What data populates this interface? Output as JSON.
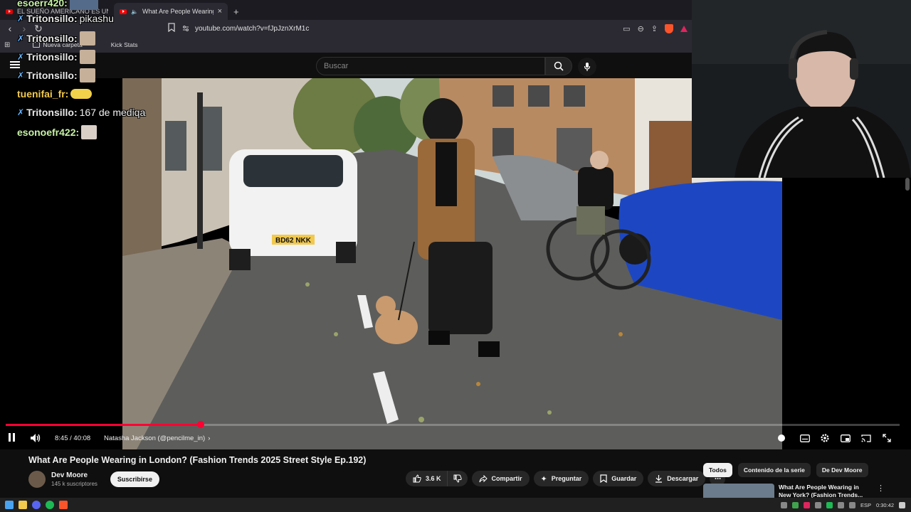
{
  "browser": {
    "tabs": [
      {
        "title": "EL SUEÑO AMERICANO ES UNA PE...",
        "active": false
      },
      {
        "title": "What Are People Wearing in L...",
        "active": true
      }
    ],
    "new_tab_symbol": "+",
    "close_symbol": "×",
    "url": "youtube.com/watch?v=fJpJznXrM1c",
    "bookmarks": [
      {
        "label": "Nueva carpeta"
      },
      {
        "label": "Kick Stats"
      }
    ]
  },
  "youtube": {
    "search_placeholder": "Buscar",
    "player": {
      "current_time": "8:45",
      "separator": " / ",
      "duration": "40:08",
      "chapter": "Natasha Jackson (@pencilme_in)",
      "progress_fraction": 0.2181,
      "plate_number": "BD62 NKK"
    },
    "video": {
      "title": "What Are People Wearing in London? (Fashion Trends 2025 Street Style Ep.192)",
      "channel_name": "Dev Moore",
      "subscribers": "145 k suscriptores",
      "subscribe_label": "Suscribirse",
      "likes": "3.6 K",
      "share_label": "Compartir",
      "ask_label": "Preguntar",
      "save_label": "Guardar",
      "download_label": "Descargar"
    },
    "filters": [
      "Todos",
      "Contenido de la serie",
      "De Dev Moore"
    ],
    "recommendation": {
      "title": "What Are People Wearing in New York? (Fashion Trends..."
    }
  },
  "chat": [
    {
      "user": "esoerr420:",
      "message": "",
      "color": "green"
    },
    {
      "user": "Tritonsillo:",
      "message": "pikashu",
      "color": "blue"
    },
    {
      "user": "Tritonsillo:",
      "message": "",
      "color": "blue"
    },
    {
      "user": "Tritonsillo:",
      "message": "",
      "color": "blue"
    },
    {
      "user": "Tritonsillo:",
      "message": "",
      "color": "blue"
    },
    {
      "user": "tuenifai_fr:",
      "message": "",
      "color": "gold"
    },
    {
      "user": "Tritonsillo:",
      "message": "167 de mediqa",
      "color": "blue"
    },
    {
      "user": "esonoefr422:",
      "message": "",
      "color": "green"
    }
  ],
  "taskbar": {
    "language": "ESP",
    "clock": "0:30:42"
  },
  "colors": {
    "accent_red": "#ff0033",
    "background": "#0f0f0f",
    "chip_bg": "#272727"
  }
}
